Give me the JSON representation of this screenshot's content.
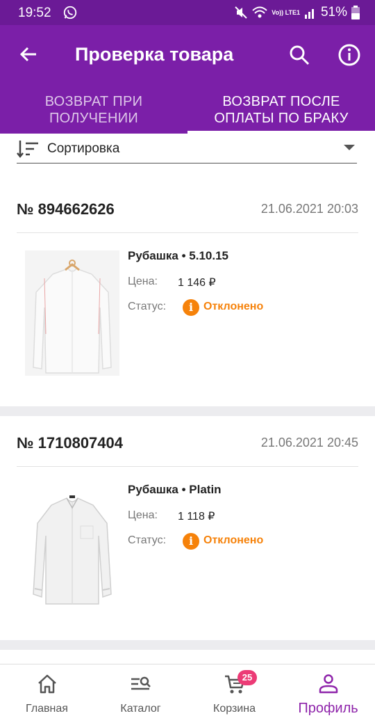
{
  "status_bar": {
    "time": "19:52",
    "volte": "Vo)) LTE1",
    "battery": "51%"
  },
  "header": {
    "title": "Проверка товара"
  },
  "tabs": [
    {
      "label": "ВОЗВРАТ ПРИ ПОЛУЧЕНИИ",
      "active": false
    },
    {
      "label": "ВОЗВРАТ ПОСЛЕ ОПЛАТЫ ПО БРАКУ",
      "active": true
    }
  ],
  "sort": {
    "label": "Сортировка"
  },
  "orders": [
    {
      "number": "№ 894662626",
      "date": "21.06.2021 20:03",
      "product": "Рубашка • 5.10.15",
      "price_label": "Цена:",
      "price": "1 146 ₽",
      "status_label": "Статус:",
      "status": "Отклонено"
    },
    {
      "number": "№ 1710807404",
      "date": "21.06.2021 20:45",
      "product": "Рубашка • Platin",
      "price_label": "Цена:",
      "price": "1 118 ₽",
      "status_label": "Статус:",
      "status": "Отклонено"
    }
  ],
  "bottom_nav": [
    {
      "label": "Главная",
      "icon": "home-icon",
      "active": false
    },
    {
      "label": "Каталог",
      "icon": "catalog-search-icon",
      "active": false
    },
    {
      "label": "Корзина",
      "icon": "cart-icon",
      "active": false,
      "badge": "25"
    },
    {
      "label": "Профиль",
      "icon": "profile-icon",
      "active": true
    }
  ],
  "colors": {
    "primary": "#7b1fa8",
    "status_bar": "#6b1a96",
    "status_warning": "#f6820a",
    "badge": "#ec3b76",
    "active_nav": "#8e24aa"
  }
}
